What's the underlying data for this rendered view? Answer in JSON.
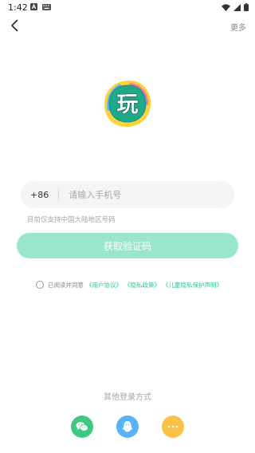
{
  "status_bar": {
    "time": "1:42",
    "icons_left": [
      "notification-a-icon",
      "keyboard-icon"
    ],
    "icons_right": [
      "wifi-icon",
      "signal-icon",
      "battery-icon"
    ]
  },
  "nav": {
    "back_icon": "chevron-left-icon",
    "more_label": "更多"
  },
  "logo": {
    "glyph": "玩",
    "colors": {
      "teal": "#1fa98b",
      "yellow": "#ffd23c",
      "pink": "#ff6fae",
      "blue": "#62b7ff"
    }
  },
  "phone": {
    "country_code": "+86",
    "placeholder": "请输入手机号",
    "value": ""
  },
  "hint": "目前仅支持中国大陆地区号码",
  "get_code_button": "获取验证码",
  "agreement": {
    "checked": false,
    "prefix": "已阅读并同意",
    "links": [
      "《用户协议》",
      "《隐私政策》",
      "《儿童隐私保护声明》"
    ]
  },
  "other_login": {
    "label": "其他登录方式",
    "providers": [
      {
        "name": "wechat",
        "icon": "wechat-icon",
        "color": "#3ec882"
      },
      {
        "name": "qq",
        "icon": "qq-penguin-icon",
        "color": "#56b3f5"
      },
      {
        "name": "more",
        "icon": "more-dots-icon",
        "color": "#fbc146"
      }
    ]
  },
  "colors": {
    "accent": "#33c592",
    "button_disabled": "#9ae6cd"
  }
}
